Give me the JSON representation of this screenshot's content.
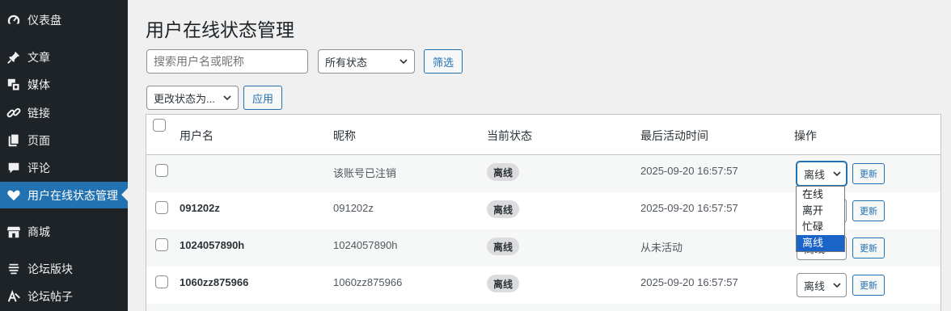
{
  "sidebar": {
    "items": [
      {
        "label": "仪表盘",
        "icon": "dashboard-icon"
      },
      {
        "label": "文章",
        "icon": "pin-icon"
      },
      {
        "label": "媒体",
        "icon": "media-icon"
      },
      {
        "label": "链接",
        "icon": "link-icon"
      },
      {
        "label": "页面",
        "icon": "page-icon"
      },
      {
        "label": "评论",
        "icon": "comment-icon"
      },
      {
        "label": "用户在线状态管理",
        "icon": "heart-icon",
        "active": true
      },
      {
        "label": "商城",
        "icon": "store-icon"
      },
      {
        "label": "论坛版块",
        "icon": "forum-icon"
      },
      {
        "label": "论坛帖子",
        "icon": "topic-icon"
      }
    ]
  },
  "page": {
    "title": "用户在线状态管理"
  },
  "filters": {
    "search_placeholder": "搜索用户名或昵称",
    "status_select": "所有状态",
    "filter_button": "筛选",
    "bulk_select": "更改状态为...",
    "apply_button": "应用"
  },
  "table": {
    "headers": {
      "username": "用户名",
      "nickname": "昵称",
      "status": "当前状态",
      "last_active": "最后活动时间",
      "actions": "操作"
    },
    "rows": [
      {
        "username": "",
        "nickname": "该账号已注销",
        "status": "离线",
        "last_active": "2025-09-20 16:57:57",
        "select": "离线",
        "button": "更新"
      },
      {
        "username": "091202z",
        "nickname": "091202z",
        "status": "离线",
        "last_active": "2025-09-20 16:57:57",
        "select": "离线",
        "button": "更新"
      },
      {
        "username": "1024057890h",
        "nickname": "1024057890h",
        "status": "离线",
        "last_active": "从未活动",
        "select": "离线",
        "button": "更新"
      },
      {
        "username": "1060zz875966",
        "nickname": "1060zz875966",
        "status": "离线",
        "last_active": "2025-09-20 16:57:57",
        "select": "离线",
        "button": "更新"
      }
    ]
  },
  "dropdown": {
    "options": [
      "在线",
      "离开",
      "忙碌",
      "离线"
    ],
    "selected": "离线"
  },
  "colors": {
    "sidebar_bg": "#1d2327",
    "accent": "#2271b1",
    "page_bg": "#f0f0f1"
  }
}
